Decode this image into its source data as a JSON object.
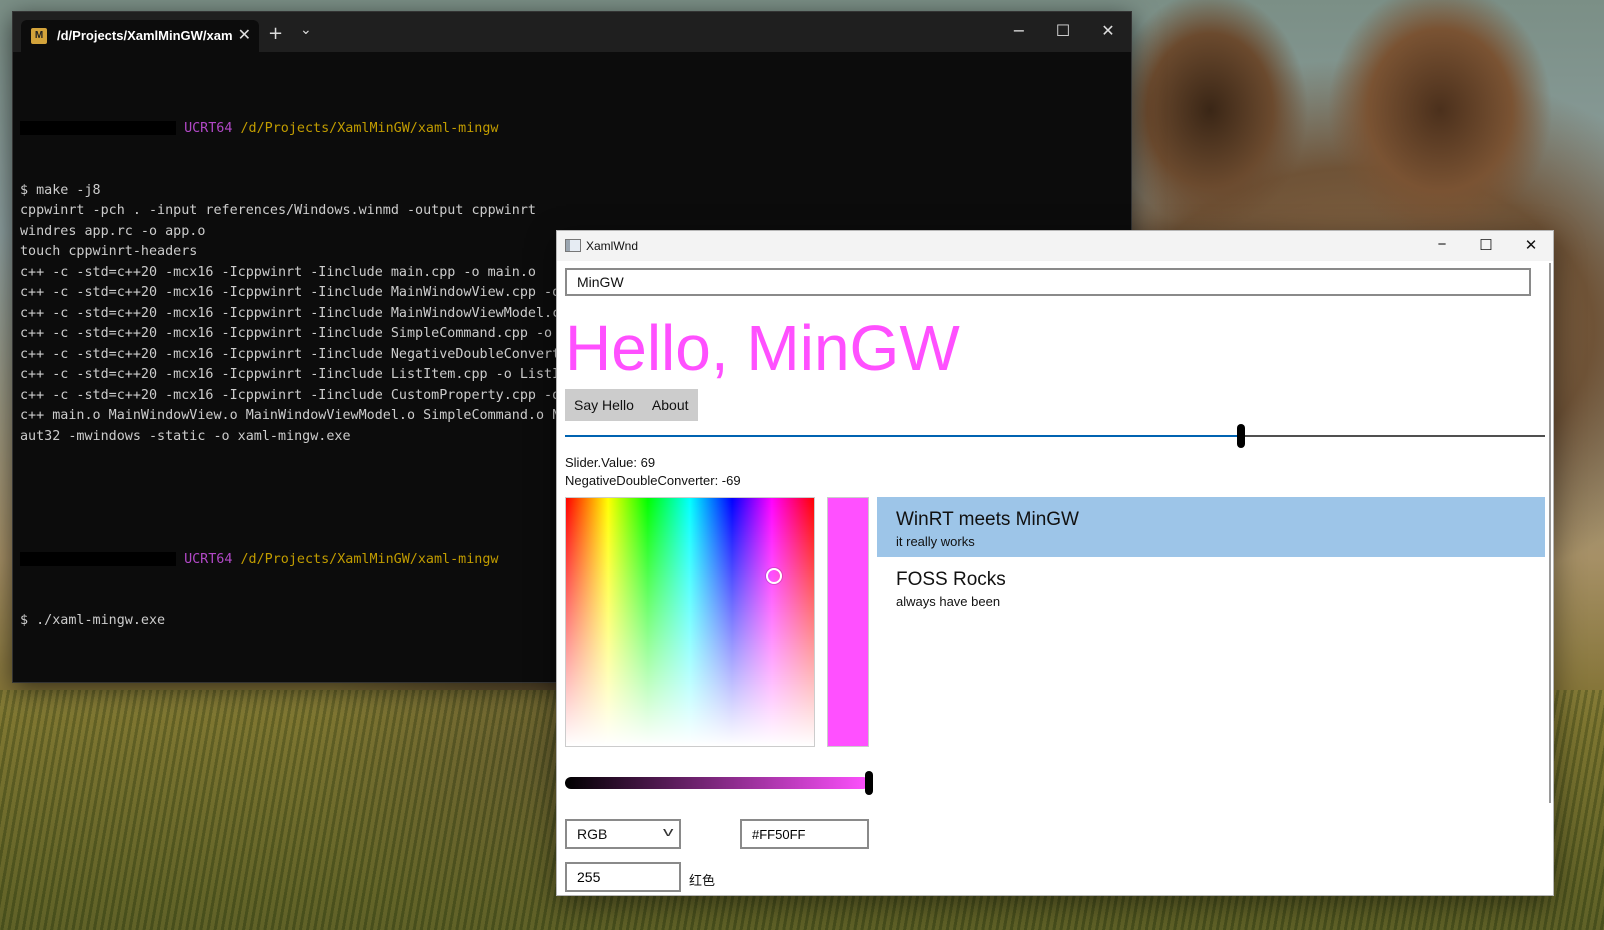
{
  "terminal": {
    "tab_title": "/d/Projects/XamlMinGW/xam",
    "tab_icon_text": "M",
    "prompt_env": "UCRT64",
    "prompt_path": "/d/Projects/XamlMinGW/xaml-mingw",
    "lines": [
      "$ make -j8",
      "cppwinrt -pch . -input references/Windows.winmd -output cppwinrt",
      "windres app.rc -o app.o",
      "touch cppwinrt-headers",
      "c++ -c -std=c++20 -mcx16 -Icppwinrt -Iinclude main.cpp -o main.o",
      "c++ -c -std=c++20 -mcx16 -Icppwinrt -Iinclude MainWindowView.cpp -o MainWindowView.o",
      "c++ -c -std=c++20 -mcx16 -Icppwinrt -Iinclude MainWindowViewModel.cpp -o MainWindowViewModel.o",
      "c++ -c -std=c++20 -mcx16 -Icppwinrt -Iinclude SimpleCommand.cpp -o Si",
      "c++ -c -std=c++20 -mcx16 -Icppwinrt -Iinclude NegativeDoubleConverter",
      "c++ -c -std=c++20 -mcx16 -Icppwinrt -Iinclude ListItem.cpp -o ListIte",
      "c++ -c -std=c++20 -mcx16 -Icppwinrt -Iinclude CustomProperty.cpp -o C",
      "c++ main.o MainWindowView.o MainWindowViewModel.o SimpleCommand.o Neg",
      "aut32 -mwindows -static -o xaml-mingw.exe"
    ],
    "last_command": "$ ./xaml-mingw.exe"
  },
  "xamlwnd": {
    "title": "XamlWnd",
    "name_value": "MinGW",
    "greeting": "Hello, MinGW",
    "buttons": {
      "say_hello": "Say Hello",
      "about": "About"
    },
    "slider": {
      "min": 0,
      "max": 100,
      "value": 69
    },
    "slider_value_label": "Slider.Value: 69",
    "negative_label": "NegativeDoubleConverter: -69",
    "color_picker": {
      "color": "#FF50FF",
      "hex_text": "#FF50FF",
      "mode": "RGB",
      "channel_value": "255",
      "channel_label": "红色",
      "alpha": 1.0,
      "marker": {
        "hue_fraction": 0.83,
        "saturation": 0.69
      }
    },
    "list_items": [
      {
        "title": "WinRT meets MinGW",
        "subtitle": "it really works",
        "selected": true
      },
      {
        "title": "FOSS Rocks",
        "subtitle": "always have been",
        "selected": false
      }
    ]
  }
}
